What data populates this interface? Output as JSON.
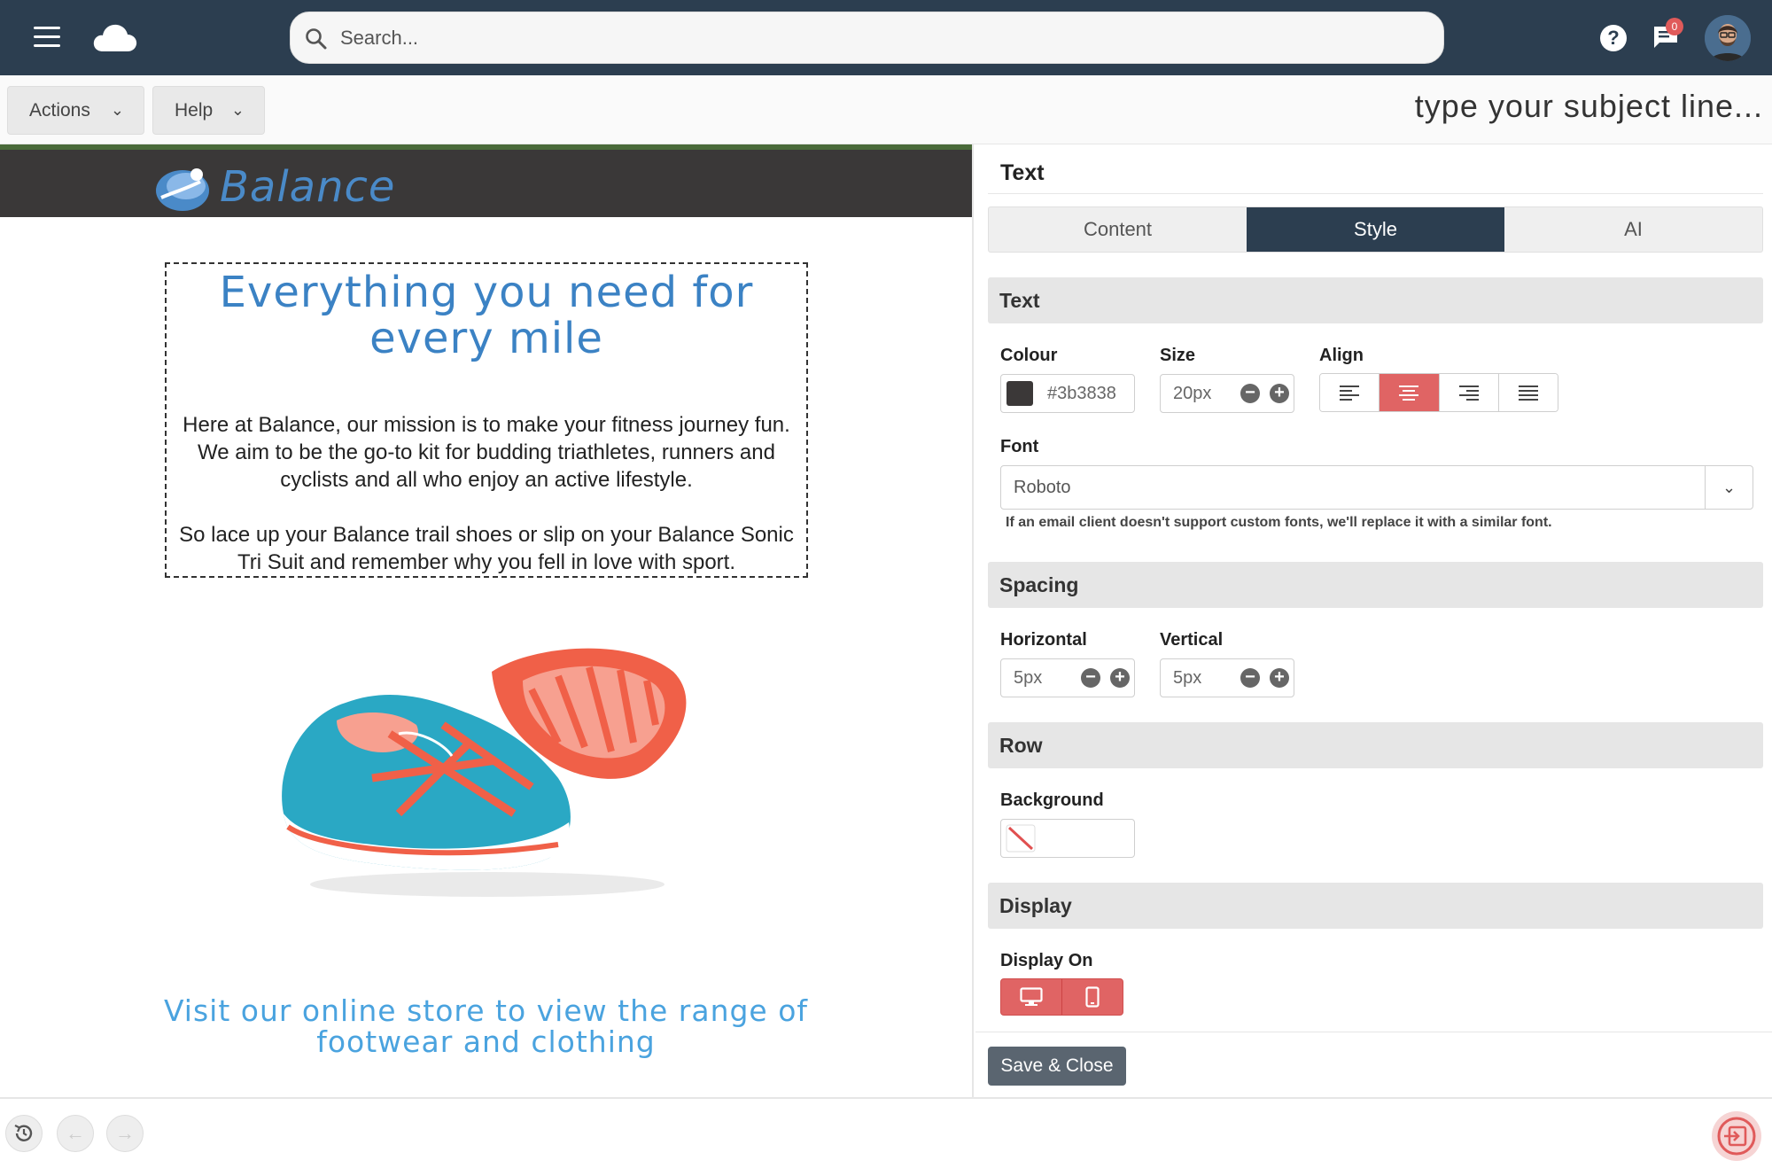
{
  "topbar": {
    "search_placeholder": "Search...",
    "help_symbol": "?",
    "notifications_count": "0",
    "icons": [
      "menu-icon",
      "cloud-icon",
      "search-icon",
      "help-icon",
      "chat-icon"
    ]
  },
  "toolbar": {
    "actions_label": "Actions",
    "help_label": "Help",
    "subject_line": "type your subject line..."
  },
  "email": {
    "brand": "Balance",
    "headline": "Everything you need for every mile",
    "paragraph1": "Here at Balance, our mission is to make your fitness journey fun. We aim to be the go-to kit for budding triathletes, runners and cyclists and all who enjoy an active lifestyle.",
    "paragraph2": "So lace up your Balance trail shoes or slip on your Balance Sonic Tri Suit and remember why you fell in love with sport.",
    "cta": "Visit our online store to view the  range of footwear and clothing"
  },
  "panel": {
    "title": "Text",
    "tabs": [
      {
        "label": "Content",
        "active": false
      },
      {
        "label": "Style",
        "active": true
      },
      {
        "label": "AI",
        "active": false
      }
    ],
    "text_section": {
      "heading": "Text",
      "colour_label": "Colour",
      "colour_value": "#3b3838",
      "size_label": "Size",
      "size_value": "20px",
      "align_label": "Align",
      "align_options": [
        "left",
        "center",
        "right",
        "justify"
      ],
      "align_selected": "center",
      "font_label": "Font",
      "font_value": "Roboto",
      "font_hint": "If an email client doesn't support custom fonts, we'll replace it with a similar font."
    },
    "spacing_section": {
      "heading": "Spacing",
      "horizontal_label": "Horizontal",
      "horizontal_value": "5px",
      "vertical_label": "Vertical",
      "vertical_value": "5px"
    },
    "row_section": {
      "heading": "Row",
      "background_label": "Background"
    },
    "display_section": {
      "heading": "Display",
      "display_on_label": "Display On",
      "options": [
        "desktop-icon",
        "mobile-icon"
      ]
    },
    "save_label": "Save & Close"
  },
  "colors": {
    "topbar": "#2c3e50",
    "accent": "#e06464",
    "headline": "#3b82c4",
    "cta": "#4aa3df"
  }
}
